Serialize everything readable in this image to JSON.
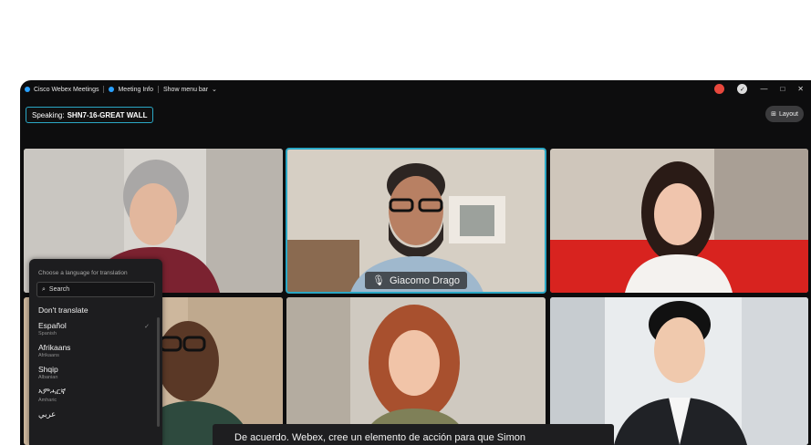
{
  "titlebar": {
    "app_name": "Cisco Webex Meetings",
    "meeting_info": "Meeting Info",
    "show_menu_bar": "Show menu bar",
    "minimize": "—",
    "maximize": "□",
    "close": "✕"
  },
  "speaking": {
    "label": "Speaking:",
    "name": "SHN7-16-GREAT WALL"
  },
  "layout_button": {
    "label": "Layout"
  },
  "active_speaker_name": "Giacomo Drago",
  "language_panel": {
    "heading": "Choose a language for translation",
    "search_placeholder": "Search",
    "items": [
      {
        "name": "Don't translate",
        "sub": ""
      },
      {
        "name": "Español",
        "sub": "Spanish"
      },
      {
        "name": "Afrikaans",
        "sub": "Afrikaans"
      },
      {
        "name": "Shqip",
        "sub": "Albanian"
      },
      {
        "name": "ኣምሓርኛ",
        "sub": "Amharic"
      },
      {
        "name": "عربي",
        "sub": ""
      }
    ]
  },
  "caption": {
    "text": "De acuerdo. Webex, cree un elemento de acción para que Simon"
  },
  "colors": {
    "accent": "#2aa7c5",
    "record": "#e8483d",
    "info": "#29a0ff"
  }
}
